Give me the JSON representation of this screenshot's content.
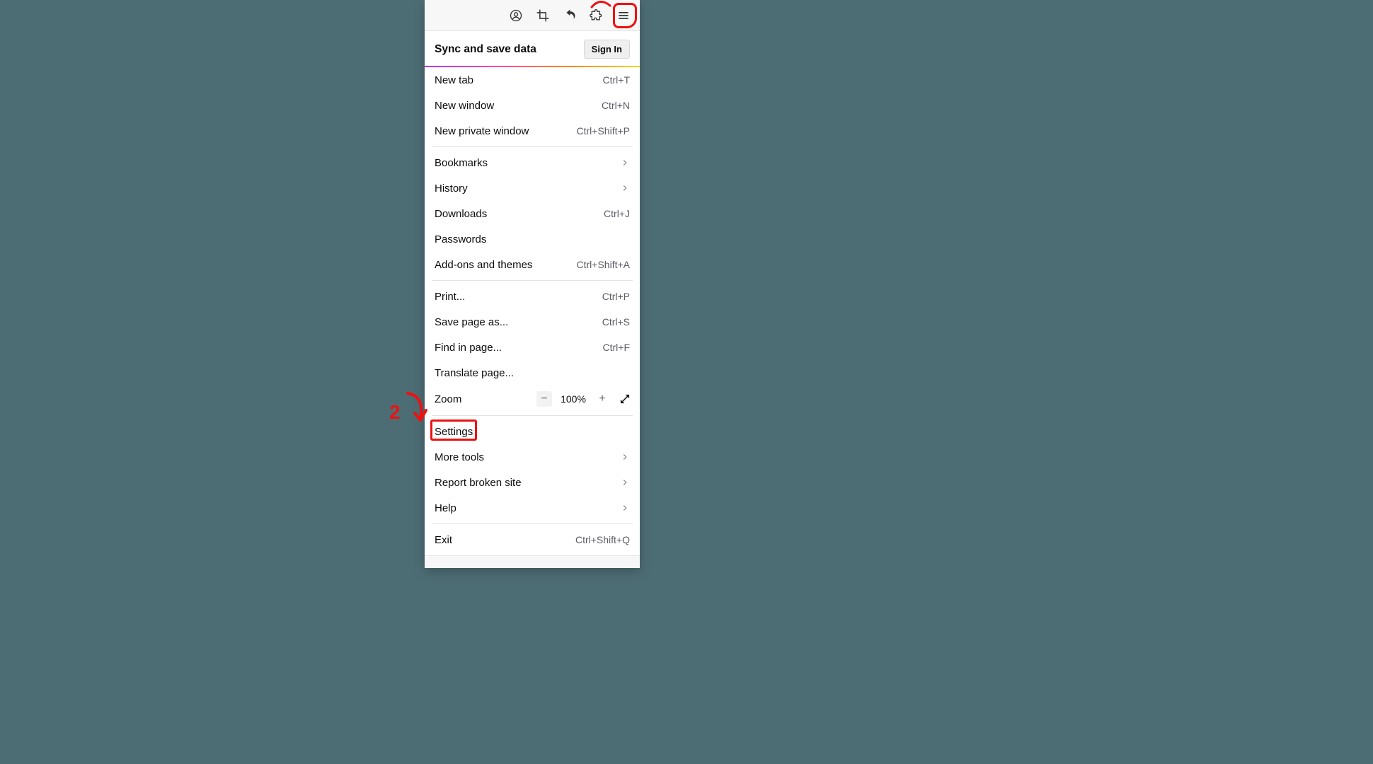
{
  "sync": {
    "title": "Sync and save data",
    "signin": "Sign In"
  },
  "items": {
    "newtab": {
      "label": "New tab",
      "shortcut": "Ctrl+T"
    },
    "newwin": {
      "label": "New window",
      "shortcut": "Ctrl+N"
    },
    "newpriv": {
      "label": "New private window",
      "shortcut": "Ctrl+Shift+P"
    },
    "bookmarks": {
      "label": "Bookmarks"
    },
    "history": {
      "label": "History"
    },
    "downloads": {
      "label": "Downloads",
      "shortcut": "Ctrl+J"
    },
    "passwords": {
      "label": "Passwords"
    },
    "addons": {
      "label": "Add-ons and themes",
      "shortcut": "Ctrl+Shift+A"
    },
    "print": {
      "label": "Print...",
      "shortcut": "Ctrl+P"
    },
    "saveas": {
      "label": "Save page as...",
      "shortcut": "Ctrl+S"
    },
    "find": {
      "label": "Find in page...",
      "shortcut": "Ctrl+F"
    },
    "translate": {
      "label": "Translate page..."
    },
    "zoom": {
      "label": "Zoom",
      "value": "100%"
    },
    "settings": {
      "label": "Settings"
    },
    "moretools": {
      "label": "More tools"
    },
    "reportsite": {
      "label": "Report broken site"
    },
    "help": {
      "label": "Help"
    },
    "exit": {
      "label": "Exit",
      "shortcut": "Ctrl+Shift+Q"
    }
  },
  "annotations": {
    "step2": "2"
  }
}
